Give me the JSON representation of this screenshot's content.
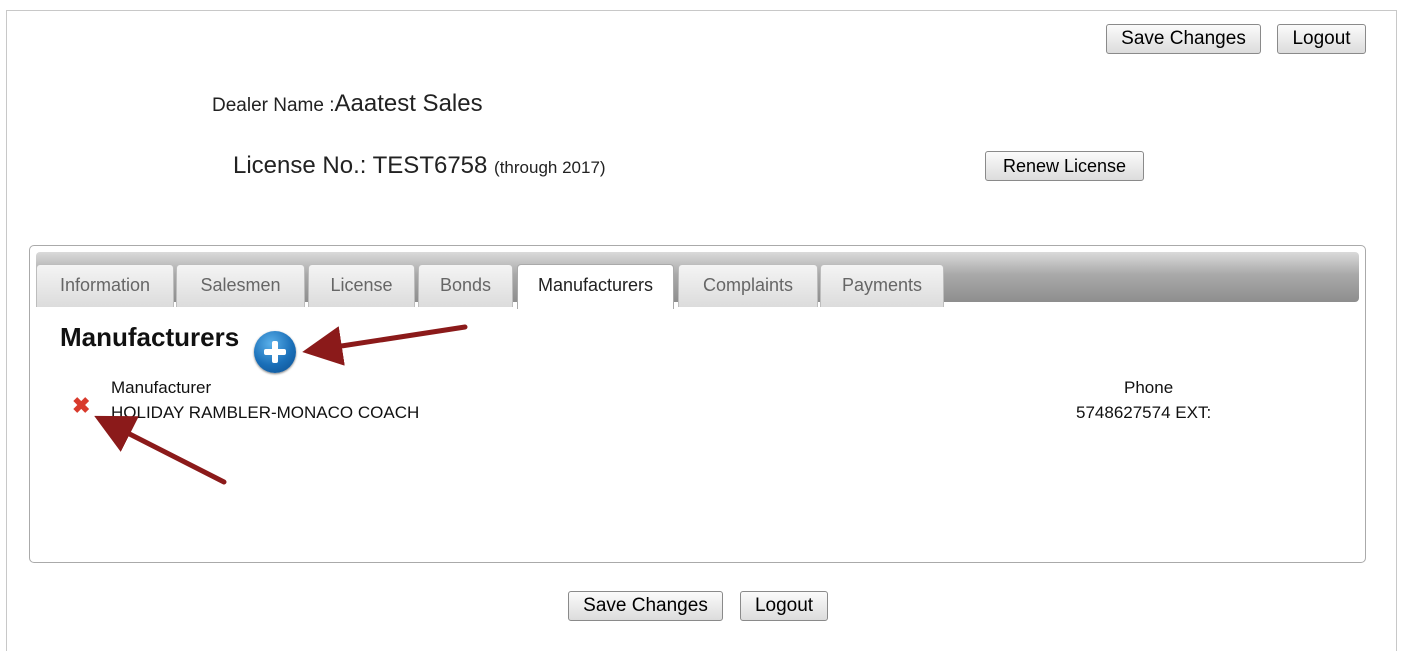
{
  "header": {
    "save_label": "Save Changes",
    "logout_label": "Logout"
  },
  "dealer": {
    "name_label": "Dealer Name :",
    "name_value": "Aaatest Sales",
    "license_label": "License No.:",
    "license_value": "TEST6758",
    "license_through": "(through 2017)",
    "renew_label": "Renew License"
  },
  "tabs": [
    {
      "label": "Information"
    },
    {
      "label": "Salesmen"
    },
    {
      "label": "License"
    },
    {
      "label": "Bonds"
    },
    {
      "label": "Manufacturers"
    },
    {
      "label": "Complaints"
    },
    {
      "label": "Payments"
    }
  ],
  "active_tab": "Manufacturers",
  "manufacturers": {
    "title": "Manufacturers",
    "add_icon": "plus-circle-icon",
    "columns": {
      "manufacturer": "Manufacturer",
      "phone": "Phone"
    },
    "rows": [
      {
        "manufacturer": "HOLIDAY RAMBLER-MONACO COACH",
        "phone": "5748627574 EXT:",
        "delete_icon": "red-x-icon"
      }
    ]
  },
  "footer": {
    "save_label": "Save Changes",
    "logout_label": "Logout"
  },
  "colors": {
    "annotation_arrow": "#8b1a1a",
    "delete_icon": "#d83a2c",
    "add_icon": "#1a6fb8"
  }
}
